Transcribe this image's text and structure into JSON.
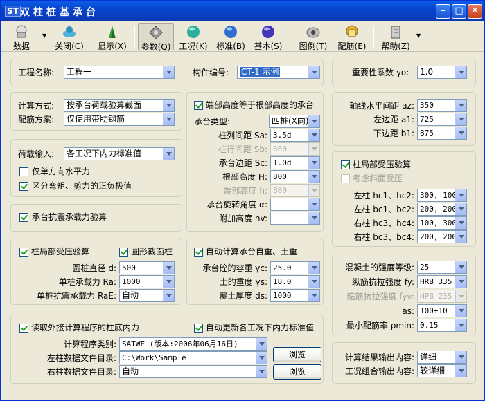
{
  "window": {
    "title": "双柱桩基承台",
    "app_badge": "ST"
  },
  "toolbar": {
    "data": "数据",
    "close": "关闭(C)",
    "display": "显示(X)",
    "params": "参数(Q)",
    "loadcase": "工况(K)",
    "standard": "标准(B)",
    "basic": "基本(S)",
    "legend": "图例(T)",
    "rebar": "配筋(E)",
    "help": "帮助(Z)"
  },
  "project": {
    "name_label": "工程名称:",
    "name": "工程一",
    "id_label": "构件编号:",
    "id": "CT-1 示例"
  },
  "importance": {
    "label": "重要性系数 γo:",
    "value": "1.0"
  },
  "calc": {
    "method_label": "计算方式:",
    "method": "按承台荷载验算截面",
    "scheme_label": "配筋方案:",
    "scheme": "仅使用带肋钢筋"
  },
  "load": {
    "input_label": "荷载输入:",
    "input": "各工况下内力标准值",
    "uniaxial": "仅单方向水平力",
    "distinguish": "区分弯矩、剪力的正负极值"
  },
  "seismic": {
    "label": "承台抗震承载力验算"
  },
  "cap": {
    "end_height_check": "端部高度等于根部高度的承台",
    "type_label": "承台类型:",
    "type": "四桩(X向)",
    "sa_label": "桩列间距 Sa:",
    "sa": "3.5d",
    "sb_label": "桩行间距 Sb:",
    "sb": "600",
    "sc_label": "承台边距 Sc:",
    "sc": "1.0d",
    "h_root_label": "根部高度 H:",
    "h_root": "800",
    "h_end_label": "端部高度 h:",
    "h_end": "800",
    "rot_label": "承台旋转角度 α:",
    "rot": "",
    "hv_label": "附加高度 hv:",
    "hv": ""
  },
  "axis": {
    "az_label": "轴线水平间距 az:",
    "az": "350",
    "a1_label": "左边距 a1:",
    "a1": "725",
    "b1_label": "下边距 b1:",
    "b1": "875"
  },
  "col_local": {
    "check": "柱局部受压验算",
    "slope": "考虑斜面受压",
    "hc_label": "左柱 hc1、hc2:",
    "hc": "300, 100",
    "bc_label": "左柱 bc1、bc2:",
    "bc": "200, 200",
    "hc34_label": "右柱 hc3、hc4:",
    "hc34": "100, 300",
    "bc34_label": "右柱 bc3、bc4:",
    "bc34": "200, 200"
  },
  "pile": {
    "local_check": "桩局部受压验算",
    "circular": "圆形截面桩",
    "d_label": "圆桩直径 d:",
    "d": "500",
    "ra_label": "单桩承载力 Ra:",
    "ra": "1000",
    "rae_label": "单桩抗震承载力 RaE:",
    "rae": "自动"
  },
  "self_weight": {
    "auto": "自动计算承台自重、土重",
    "gc_label": "承台砼的容重 γc:",
    "gc": "25.0",
    "gs_label": "土的重度 γs:",
    "gs": "18.0",
    "ds_label": "覆土厚度 ds:",
    "ds": "1000"
  },
  "material": {
    "concrete_label": "混凝土的强度等级:",
    "concrete": "25",
    "fy_label": "纵筋抗拉强度 fy:",
    "fy": "HRB 335",
    "fyv_label": "箍筋抗拉强度 fyv:",
    "fyv": "HPB 235",
    "as_label": "as:",
    "as": "100+10",
    "pmin_label": "最小配筋率 ρmin:",
    "pmin": "0.15"
  },
  "external": {
    "read_check": "读取外接计算程序的柱底内力",
    "auto_update": "自动更新各工况下内力标准值",
    "program_label": "计算程序类别:",
    "program": "SATWE (版本:2006年06月16日)",
    "left_dir_label": "左柱数据文件目录:",
    "left_dir": "C:\\Work\\Sample",
    "right_dir_label": "右柱数据文件目录:",
    "right_dir": "自动",
    "browse1": "浏览",
    "browse2": "浏览"
  },
  "output": {
    "result_label": "计算结果输出内容:",
    "result": "详细",
    "combo_label": "工况组合输出内容:",
    "combo": "较详细"
  }
}
